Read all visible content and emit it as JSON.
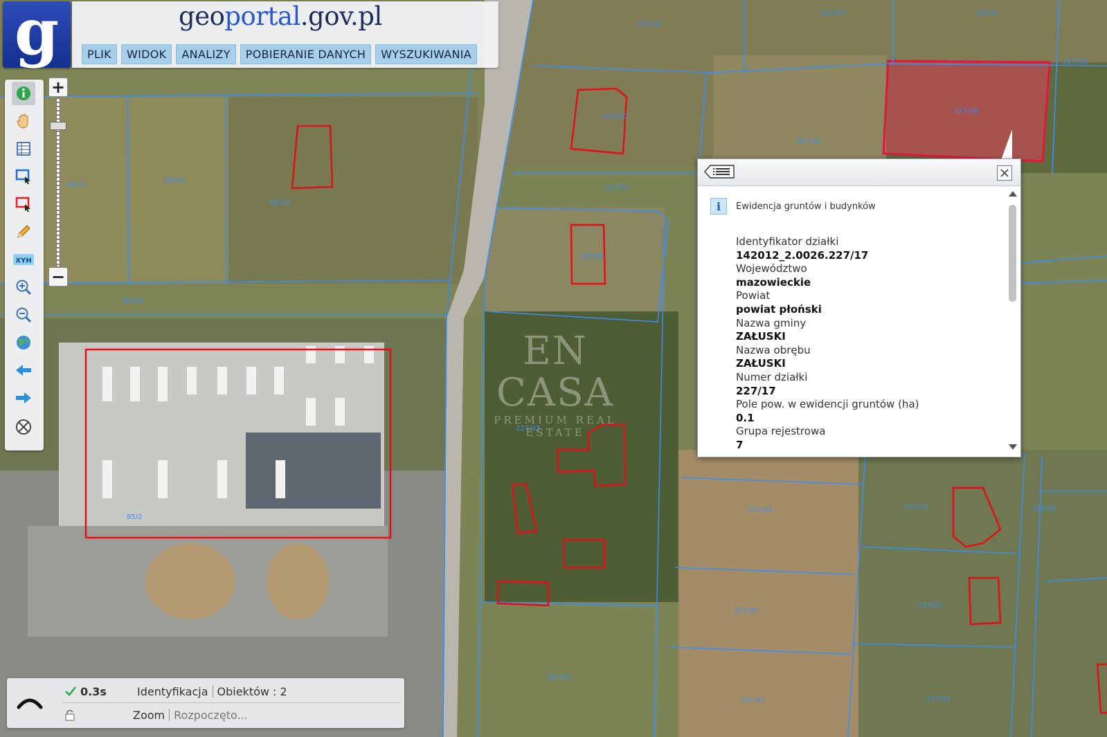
{
  "header": {
    "logo_letter": "g",
    "brand_g": "g",
    "brand_eo": "eo",
    "brand_portal": "portal",
    "brand_domain": ".gov.pl",
    "menu": [
      "PLIK",
      "WIDOK",
      "ANALIZY",
      "POBIERANIE DANYCH",
      "WYSZUKIWANIA"
    ]
  },
  "toolbar": {
    "tools": [
      "info-icon",
      "pan-hand-icon",
      "table-icon",
      "select-rectangle-icon",
      "select-rectangle-red-icon",
      "pencil-icon",
      "xyh-icon",
      "zoom-in-icon",
      "zoom-out-icon",
      "globe-icon",
      "back-arrow-icon",
      "forward-arrow-icon",
      "clear-icon"
    ],
    "xyh_label": "XYH"
  },
  "zoom": {
    "plus": "+",
    "minus": "−"
  },
  "popup": {
    "layer_icon": "i",
    "layer_name": "Ewidencja gruntów i budynków",
    "attributes": [
      {
        "label": "Identyfikator działki",
        "value": "142012_2.0026.227/17"
      },
      {
        "label": "Województwo",
        "value": "mazowieckie"
      },
      {
        "label": "Powiat",
        "value": "powiat płoński"
      },
      {
        "label": "Nazwa gminy",
        "value": "ZAŁUSKI"
      },
      {
        "label": "Nazwa obrębu",
        "value": "ZAŁUSKI"
      },
      {
        "label": "Numer działki",
        "value": "227/17"
      },
      {
        "label": "Pole pow. w ewidencji gruntów (ha)",
        "value": "0.1"
      },
      {
        "label": "Grupa rejestrowa",
        "value": "7"
      }
    ]
  },
  "watermark": {
    "line1": "EN CASA",
    "line2": "PREMIUM REAL ESTATE"
  },
  "statusbar": {
    "time": "0.3s",
    "action": "Identyfikacja",
    "objects": "Obiektów : 2",
    "zoom": "Zoom",
    "started": "Rozpoczęto..."
  },
  "parcel_labels": [
    "227/28",
    "227/27",
    "227/10",
    "227/9",
    "85/11",
    "85/10",
    "85/12",
    "227/30",
    "227/31",
    "227/32",
    "85/14",
    "227/33",
    "227/34",
    "227/35",
    "227/36",
    "227/21",
    "227/22",
    "227/19",
    "227/18",
    "227/41",
    "227/23",
    "85/2",
    "227/16",
    "227/17"
  ],
  "colors": {
    "parcel_line": "#3a8df2",
    "building_line": "#e0101a",
    "selected_fill": "#e0405a"
  }
}
